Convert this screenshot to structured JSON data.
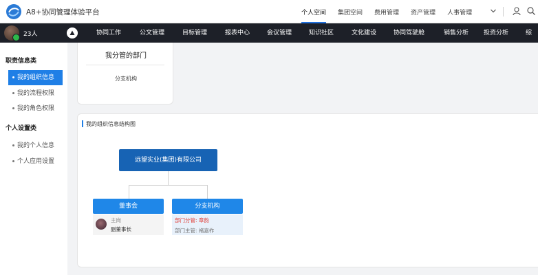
{
  "header": {
    "app_title": "A8+协同管理体验平台",
    "top_tabs": [
      {
        "label": "个人空间",
        "active": true
      },
      {
        "label": "集团空间",
        "active": false
      },
      {
        "label": "费用管理",
        "active": false
      },
      {
        "label": "资产管理",
        "active": false
      },
      {
        "label": "人事管理",
        "active": false
      }
    ],
    "icons": [
      "chevron-down-icon",
      "user-settings-icon",
      "search-icon"
    ]
  },
  "navbar": {
    "user_count": "23人",
    "items": [
      "协同工作",
      "公文管理",
      "目标管理",
      "报表中心",
      "会议管理",
      "知识社区",
      "文化建设",
      "协同驾驶舱",
      "销售分析",
      "投资分析",
      "综"
    ]
  },
  "sidebar": {
    "sections": [
      {
        "title": "职责信息类",
        "items": [
          {
            "label": "我的组织信息",
            "active": true
          },
          {
            "label": "我的流程权限",
            "active": false
          },
          {
            "label": "我的角色权限",
            "active": false
          }
        ]
      },
      {
        "title": "个人设置类",
        "items": [
          {
            "label": "我的个人信息",
            "active": false
          },
          {
            "label": "个人应用设置",
            "active": false
          }
        ]
      }
    ]
  },
  "managed_dept_card": {
    "title": "我分管的部门",
    "items": [
      "分支机构"
    ]
  },
  "org_chart": {
    "title": "我的组织信息结构图",
    "root": "远望实业(集团)有限公司",
    "children": [
      {
        "name": "董事会",
        "member_role": "主岗",
        "member_name": "副董事长"
      },
      {
        "name": "分支机构",
        "line1": "部门分管: 章韵",
        "line2": "部门主管: 褚嘉祚"
      }
    ]
  },
  "colors": {
    "accent": "#1f7fe6",
    "root_node": "#1763b4",
    "navbar": "#1d2028",
    "alert_red": "#e0403a"
  }
}
